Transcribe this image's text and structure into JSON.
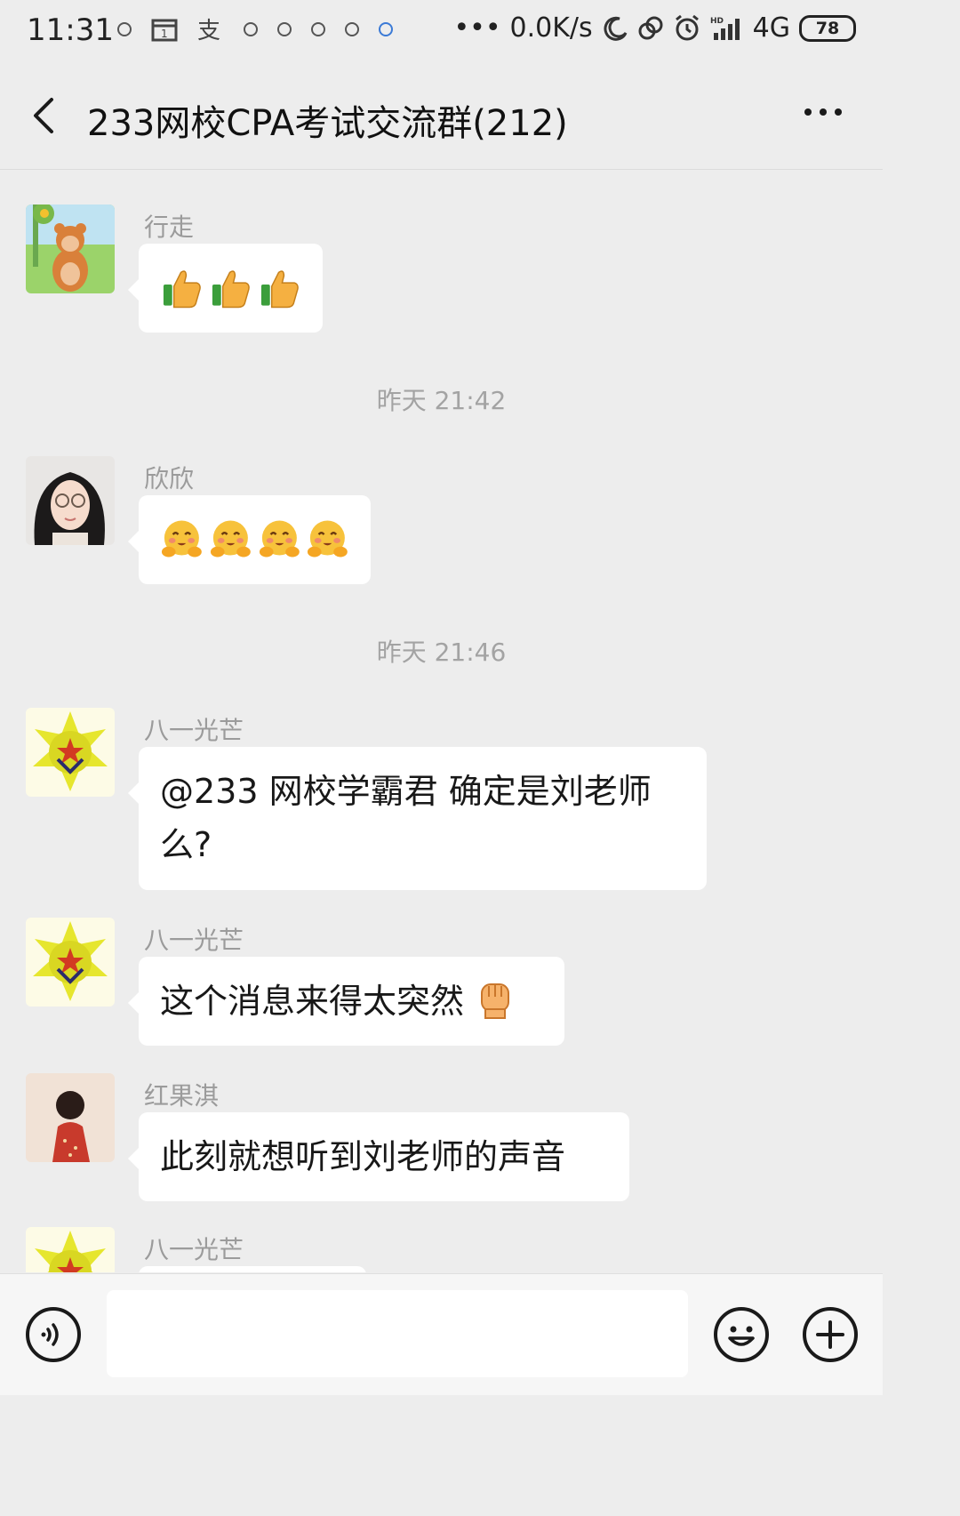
{
  "status_bar": {
    "time": "11:31",
    "network_speed": "0.0K/s",
    "signal": "4G",
    "battery": "78"
  },
  "header": {
    "title": "233网校CPA考试交流群(212)"
  },
  "messages": [
    {
      "sender": "行走",
      "type": "emoji",
      "emojis": [
        "thumbs-up",
        "thumbs-up",
        "thumbs-up"
      ]
    },
    {
      "timestamp": "昨天 21:42"
    },
    {
      "sender": "欣欣",
      "type": "emoji",
      "emojis": [
        "hugging-face",
        "hugging-face",
        "hugging-face",
        "hugging-face"
      ]
    },
    {
      "timestamp": "昨天 21:46"
    },
    {
      "sender": "八一光芒",
      "type": "text",
      "text": "@233 网校学霸君 确定是刘老师么?"
    },
    {
      "sender": "八一光芒",
      "type": "text",
      "text": "这个消息来得太突然",
      "trailing_emoji": "raised-fist"
    },
    {
      "sender": "红果淇",
      "type": "text",
      "text": "此刻就想听到刘老师的声音"
    },
    {
      "sender": "八一光芒",
      "type": "partial"
    }
  ],
  "colors": {
    "background": "#ededed",
    "bubble": "#ffffff",
    "sender_name": "#9b9b9b",
    "timestamp": "#a3a3a3"
  }
}
